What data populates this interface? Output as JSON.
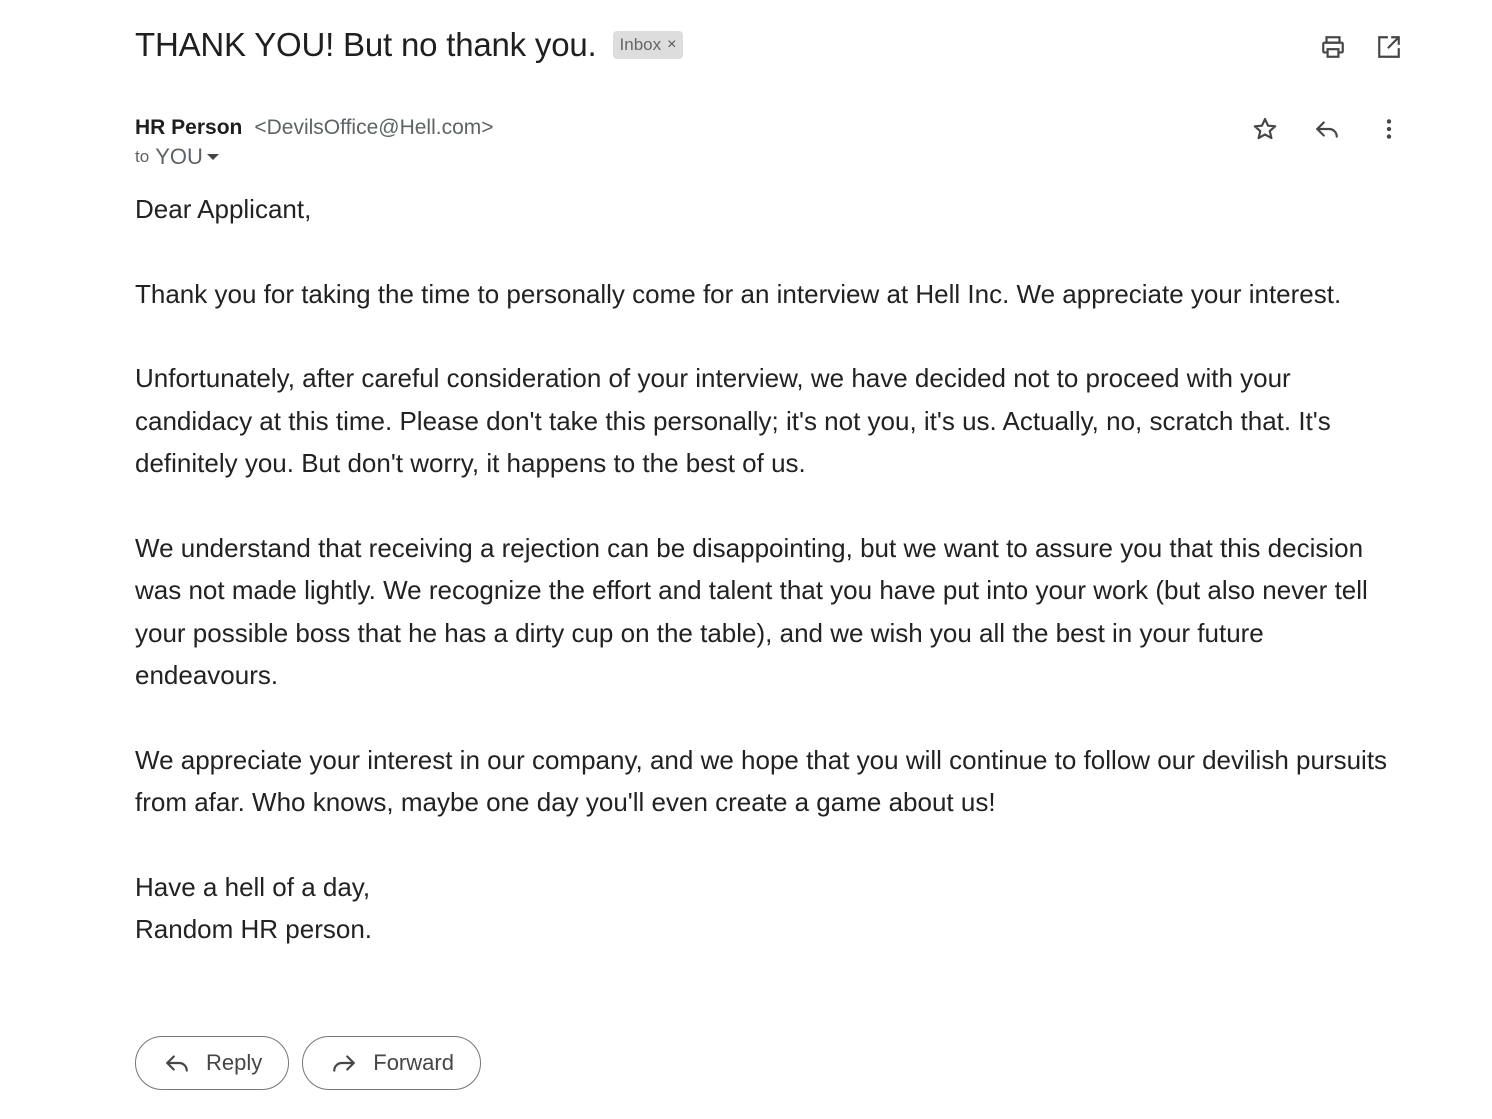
{
  "email": {
    "subject": "THANK YOU! But no thank you.",
    "label": "Inbox",
    "label_remove": "×",
    "sender": {
      "name": "HR Person",
      "email": "<DevilsOffice@Hell.com>"
    },
    "to_word": "to",
    "to_name": "YOU",
    "body": {
      "greeting": "Dear Applicant,",
      "paragraphs": [
        "Thank you for taking the time to personally come for an interview at Hell Inc. We appreciate your interest.",
        "Unfortunately, after careful consideration of your interview, we have decided not to proceed with your candidacy at this time. Please don't take this personally; it's not you, it's us. Actually, no, scratch that. It's definitely you. But don't worry, it happens to the best of us.",
        "We understand that receiving a rejection can be disappointing, but we want to assure you that this decision was not made lightly. We recognize the effort and talent that you have put into your work (but also never tell your possible boss that he has a dirty cup on the table), and we wish you all the best in your future endeavours.",
        "We appreciate your interest in our company, and we hope that you will continue to follow our devilish pursuits from afar. Who knows, maybe one day you'll even create a game about us!"
      ],
      "sign_off": "Have a hell of a day,",
      "signature": "Random HR person."
    }
  },
  "toolbar": {
    "print_icon": "printer-icon",
    "open_new_window_icon": "open-in-new-icon"
  },
  "message_actions": {
    "star_icon": "star-icon",
    "reply_icon": "reply-icon",
    "more_icon": "more-vert-icon"
  },
  "buttons": {
    "reply_label": "Reply",
    "forward_label": "Forward"
  }
}
